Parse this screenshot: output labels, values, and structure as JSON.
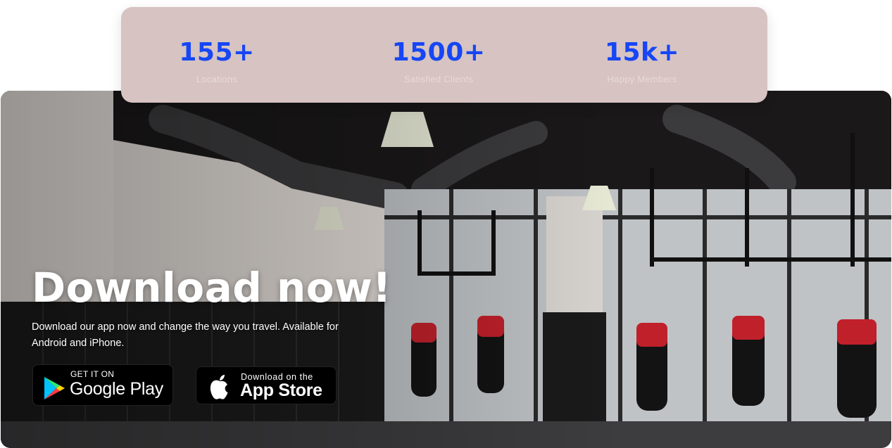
{
  "stats": [
    {
      "value": "155+",
      "label": "Locations"
    },
    {
      "value": "1500+",
      "label": "Satisfied Clients"
    },
    {
      "value": "15k+",
      "label": "Happy Members"
    }
  ],
  "hero": {
    "title": "Download now!",
    "description": "Download our app now and change the way you travel. Available for Android and iPhone."
  },
  "buttons": {
    "google_play": {
      "small": "GET IT ON",
      "big": "Google Play",
      "icon": "google-play-icon"
    },
    "app_store": {
      "small": "Download on the",
      "big": "App Store",
      "icon": "apple-icon"
    }
  },
  "colors": {
    "stat_accent": "#1646f5",
    "stats_card_bg": "#d6c3c2",
    "button_bg": "#000000"
  }
}
